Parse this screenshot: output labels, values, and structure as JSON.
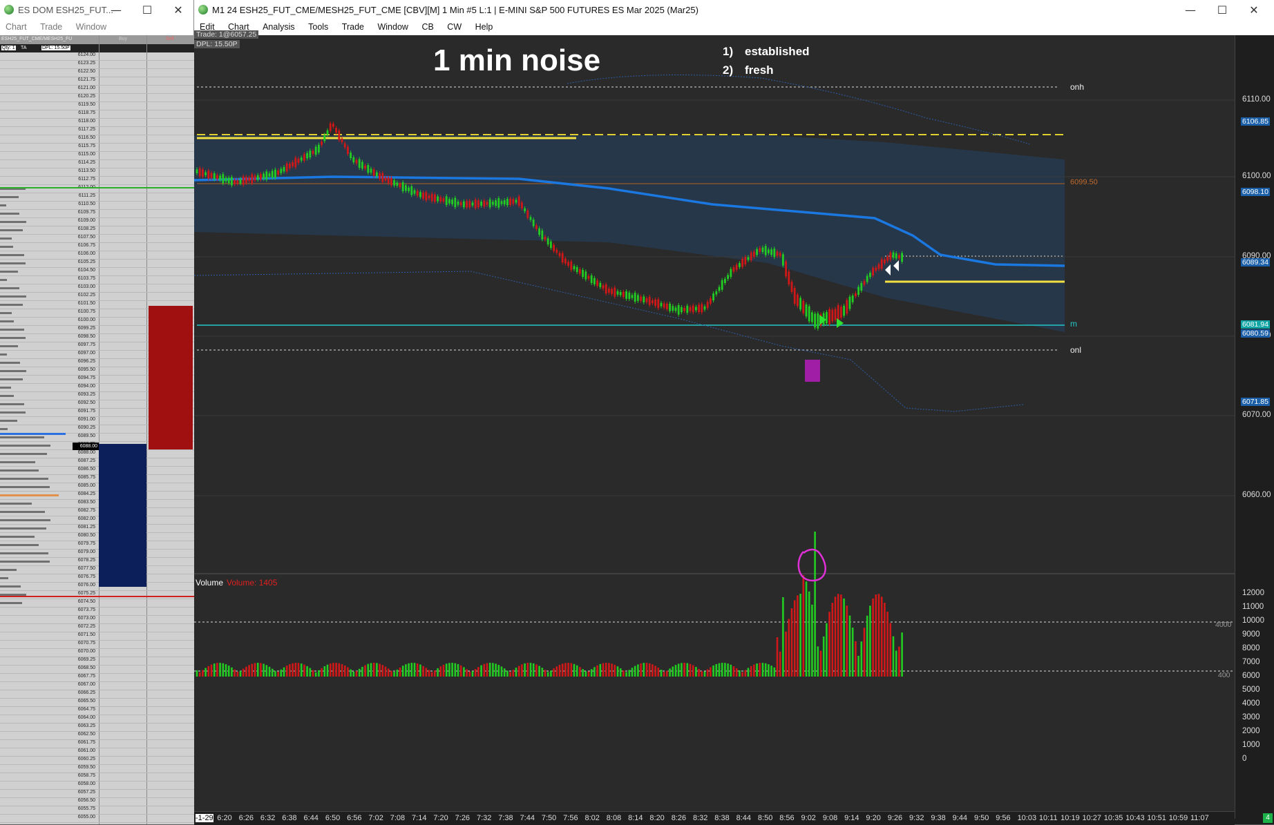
{
  "dom_window": {
    "title": "ES DOM ESH25_FUT...",
    "menu": [
      "Chart",
      "Trade",
      "Window"
    ],
    "header": {
      "symbol": "ESH25_FUT_CME/MESH25_FU",
      "qty": "Qty: 1",
      "ta": "TA",
      "dpl": "DPL: 15.50P",
      "buy": "Buy",
      "sell": "Sell"
    },
    "prices": [
      "6124.00",
      "6123.25",
      "6122.50",
      "6121.75",
      "6121.00",
      "6120.25",
      "6119.50",
      "6118.75",
      "6118.00",
      "6117.25",
      "6116.50",
      "6115.75",
      "6115.00",
      "6114.25",
      "6113.50",
      "6112.75",
      "6112.00",
      "6111.25",
      "6110.50",
      "6109.75",
      "6109.00",
      "6108.25",
      "6107.50",
      "6106.75",
      "6106.00",
      "6105.25",
      "6104.50",
      "6103.75",
      "6103.00",
      "6102.25",
      "6101.50",
      "6100.75",
      "6100.00",
      "6099.25",
      "6098.50",
      "6097.75",
      "6097.00",
      "6096.25",
      "6095.50",
      "6094.75",
      "6094.00",
      "6093.25",
      "6092.50",
      "6091.75",
      "6091.00",
      "6090.25",
      "6089.50",
      "6088.75",
      "6088.00",
      "6087.25",
      "6086.50",
      "6085.75",
      "6085.00",
      "6084.25",
      "6083.50",
      "6082.75",
      "6082.00",
      "6081.25",
      "6080.50",
      "6079.75",
      "6079.00",
      "6078.25",
      "6077.50",
      "6076.75",
      "6076.00",
      "6075.25",
      "6074.50",
      "6073.75",
      "6073.00",
      "6072.25",
      "6071.50",
      "6070.75",
      "6070.00",
      "6069.25",
      "6068.50",
      "6067.75",
      "6067.00",
      "6066.25",
      "6065.50",
      "6064.75",
      "6064.00",
      "6063.25",
      "6062.50",
      "6061.75",
      "6061.00",
      "6060.25",
      "6059.50",
      "6058.75",
      "6058.00",
      "6057.25",
      "6056.50",
      "6055.75",
      "6055.00"
    ],
    "current_price": "6088.00"
  },
  "chart_window": {
    "title": "M1 24 ESH25_FUT_CME/MESH25_FUT_CME [CBV][M]  1 Min  #5 L:1 | E-MINI S&P 500 FUTURES ES Mar 2025 (Mar25)",
    "menu": [
      "Edit",
      "Chart",
      "Analysis",
      "Tools",
      "Trade",
      "Window",
      "CB",
      "CW",
      "Help"
    ],
    "trade_info": "Trade: 1@6057.25",
    "dpl_info": "DPL: 15.50P",
    "headline": "1 min noise",
    "notes": [
      {
        "num": "1)",
        "text": "established"
      },
      {
        "num": "2)",
        "text": "fresh"
      }
    ],
    "line_labels": {
      "onh": "onh",
      "onl": "onl",
      "m": "m",
      "level_6099": "6099.50"
    },
    "price_axis": [
      "6110.00",
      "6100.00",
      "6090.00",
      "6080.00",
      "6070.00",
      "6060.00"
    ],
    "price_tags": [
      {
        "value": "6106.85",
        "color": "#1a5fa8"
      },
      {
        "value": "6098.10",
        "color": "#1a5fa8"
      },
      {
        "value": "6089.34",
        "color": "#1a5fa8"
      },
      {
        "value": "6081.94",
        "color": "#12a5a5"
      },
      {
        "value": "6080.59",
        "color": "#1a5fa8"
      },
      {
        "value": "6071.85",
        "color": "#1a5fa8"
      }
    ],
    "volume_panel": {
      "label": "Volume",
      "value_label": "Volume: 1405",
      "threshold_high": "4000",
      "threshold_low": "400"
    },
    "volume_axis": [
      "12000",
      "11000",
      "10000",
      "9000",
      "8000",
      "7000",
      "6000",
      "5000",
      "4000",
      "3000",
      "2000",
      "1000",
      "0"
    ],
    "time_axis": [
      "-1-29",
      "6:20",
      "6:26",
      "6:32",
      "6:38",
      "6:44",
      "6:50",
      "6:56",
      "7:02",
      "7:08",
      "7:14",
      "7:20",
      "7:26",
      "7:32",
      "7:38",
      "7:44",
      "7:50",
      "7:56",
      "8:02",
      "8:08",
      "8:14",
      "8:20",
      "8:26",
      "8:32",
      "8:38",
      "8:44",
      "8:50",
      "8:56",
      "9:02",
      "9:08",
      "9:14",
      "9:20",
      "9:26",
      "9:32",
      "9:38",
      "9:44",
      "9:50",
      "9:56",
      "10:03",
      "10:11",
      "10:19",
      "10:27",
      "10:35",
      "10:43",
      "10:51",
      "10:59",
      "11:07"
    ],
    "badge": "4"
  }
}
